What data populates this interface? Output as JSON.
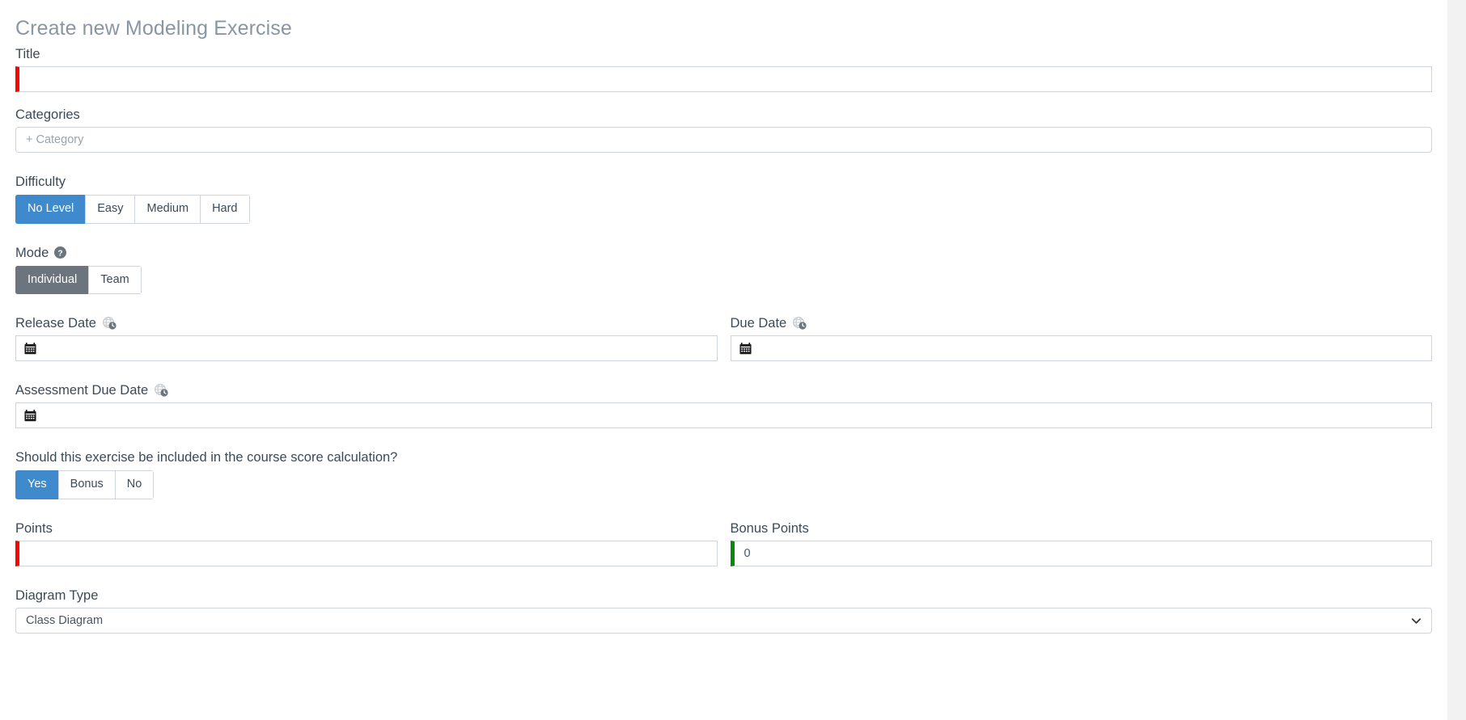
{
  "page": {
    "title": "Create new Modeling Exercise"
  },
  "fields": {
    "title": {
      "label": "Title",
      "value": "",
      "state": "invalid"
    },
    "categories": {
      "label": "Categories",
      "placeholder": "+ Category",
      "value": ""
    },
    "difficulty": {
      "label": "Difficulty",
      "options": [
        "No Level",
        "Easy",
        "Medium",
        "Hard"
      ],
      "selected": "No Level"
    },
    "mode": {
      "label": "Mode",
      "help_icon": "help-circle-icon",
      "options": [
        "Individual",
        "Team"
      ],
      "selected": "Individual"
    },
    "release_date": {
      "label": "Release Date",
      "icon": "globe-clock-icon",
      "input_icon": "calendar-icon",
      "value": ""
    },
    "due_date": {
      "label": "Due Date",
      "icon": "globe-clock-icon",
      "input_icon": "calendar-icon",
      "value": ""
    },
    "assessment_due_date": {
      "label": "Assessment Due Date",
      "icon": "globe-clock-icon",
      "input_icon": "calendar-icon",
      "value": ""
    },
    "included_in_score": {
      "label": "Should this exercise be included in the course score calculation?",
      "options": [
        "Yes",
        "Bonus",
        "No"
      ],
      "selected": "Yes"
    },
    "points": {
      "label": "Points",
      "value": "",
      "state": "invalid"
    },
    "bonus_points": {
      "label": "Bonus Points",
      "value": "0",
      "state": "valid"
    },
    "diagram_type": {
      "label": "Diagram Type",
      "selected": "Class Diagram",
      "chevron_icon": "chevron-down-icon"
    }
  },
  "colors": {
    "primary": "#3e8acc",
    "secondary": "#6c757d",
    "invalid": "#ff0000",
    "valid": "#0a8a0a",
    "title": "#8a96a3",
    "border": "#ced4da"
  }
}
